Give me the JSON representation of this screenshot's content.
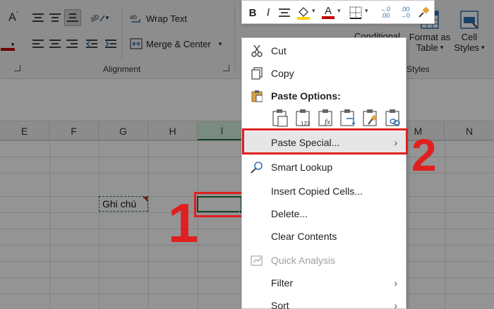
{
  "ribbon": {
    "wrap_text_label": "Wrap Text",
    "merge_center_label": "Merge & Center",
    "alignment_group_label": "Alignment",
    "conditional_label": "Conditional",
    "format_as_table_line1": "Format as",
    "format_as_table_line2": "Table",
    "cell_styles_line1": "Cell",
    "cell_styles_line2": "Styles",
    "styles_group_label": "Styles",
    "font_color": "#c00000",
    "fill_color": "#ffd700"
  },
  "columns": [
    {
      "label": "E",
      "selected": false
    },
    {
      "label": "F",
      "selected": false
    },
    {
      "label": "G",
      "selected": false
    },
    {
      "label": "H",
      "selected": false
    },
    {
      "label": "I",
      "selected": true
    },
    {
      "label": "M",
      "selected": false
    },
    {
      "label": "N",
      "selected": false
    }
  ],
  "cells": {
    "note_cell_text": "Ghi chú"
  },
  "mini_toolbar": {
    "bold": "B",
    "italic": "I",
    "font_color_letter": "A",
    "decimal_increase": "←0 .00",
    "decimal_decrease": ".00 →0"
  },
  "context_menu": {
    "cut": "Cut",
    "copy": "Copy",
    "paste_options": "Paste Options:",
    "paste_special": "Paste Special...",
    "smart_lookup": "Smart Lookup",
    "insert_copied_cells": "Insert Copied Cells...",
    "delete": "Delete...",
    "clear_contents": "Clear Contents",
    "quick_analysis": "Quick Analysis",
    "filter": "Filter",
    "sort": "Sort"
  },
  "annotations": {
    "step_1": "1",
    "step_2": "2",
    "highlight_color": "#e02020"
  }
}
